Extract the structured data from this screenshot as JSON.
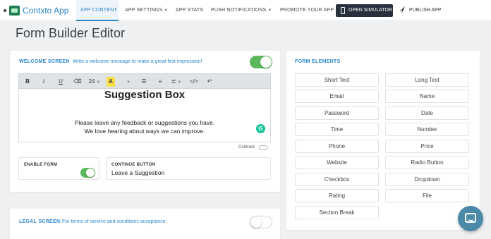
{
  "brand": {
    "logo_text": "Contxto App"
  },
  "nav": {
    "items": [
      {
        "label": "APP CONTENT"
      },
      {
        "label": "APP SETTINGS"
      },
      {
        "label": "APP STATS"
      },
      {
        "label": "PUSH NOTIFICATIONS"
      },
      {
        "label": "PROMOTE YOUR APP"
      }
    ],
    "simulator_label": "OPEN SIMULATOR",
    "publish_label": "PUBLISH APP"
  },
  "page": {
    "title": "Form Builder Editor"
  },
  "welcome": {
    "title": "WELCOME SCREEN",
    "subtitle": "Write a welcome message to make a great first impression!",
    "enabled": true,
    "toolbar": {
      "bold": "B",
      "italic": "I",
      "underline": "U",
      "font_size": "24",
      "color": "A"
    },
    "content": {
      "heading": "Suggestion Box",
      "line1": "Please leave any feedback or suggestions you have.",
      "line2": "We love hearing about ways we can improve."
    },
    "grammarly": "G",
    "contrast_label": "Contrast",
    "enable_form_label": "ENABLE FORM",
    "enable_form_on": true,
    "continue_label": "CONTINUE BUTTON",
    "continue_value": "Leave a Suggestion"
  },
  "legal": {
    "title": "LEGAL SCREEN",
    "subtitle": "For terms of service and conditions acceptance",
    "enabled": false
  },
  "form_elements": {
    "title": "FORM ELEMENTS",
    "items": [
      "Short Text",
      "Long Text",
      "Email",
      "Name",
      "Password",
      "Date",
      "Time",
      "Number",
      "Phone",
      "Price",
      "Website",
      "Radio Button",
      "Checkbox",
      "Dropdown",
      "Rating",
      "File",
      "Section Break"
    ]
  },
  "colors": {
    "accent": "#2a86c8",
    "toggle_on": "#5cb85c",
    "simulator_bg": "#27303d",
    "chat": "#4a8aa8"
  }
}
